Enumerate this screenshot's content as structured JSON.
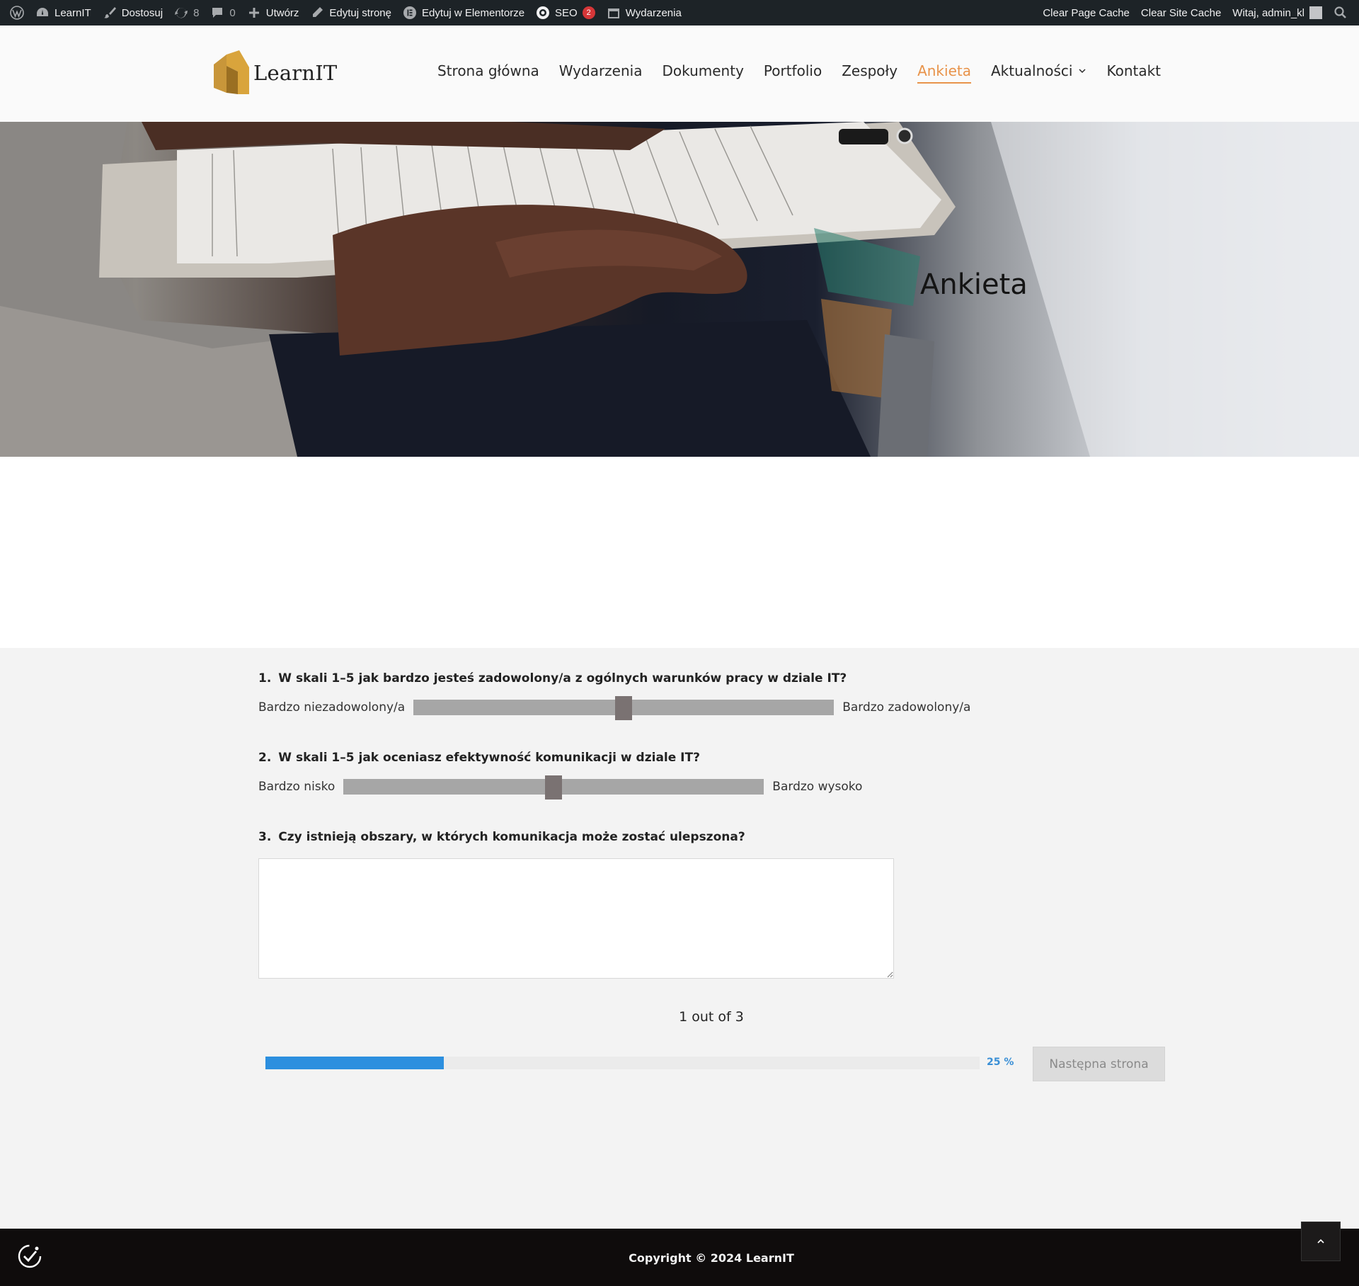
{
  "admin_bar": {
    "site_name": "LearnIT",
    "customize": "Dostosuj",
    "updates_count": "8",
    "comments_count": "0",
    "new": "Utwórz",
    "edit_page": "Edytuj stronę",
    "edit_elementor": "Edytuj w Elementorze",
    "seo": "SEO",
    "seo_badge": "2",
    "events": "Wydarzenia",
    "clear_page_cache": "Clear Page Cache",
    "clear_site_cache": "Clear Site Cache",
    "greeting": "Witaj, admin_kl"
  },
  "header": {
    "logo_text": "LearnIT",
    "nav": [
      {
        "label": "Strona główna"
      },
      {
        "label": "Wydarzenia"
      },
      {
        "label": "Dokumenty"
      },
      {
        "label": "Portfolio"
      },
      {
        "label": "Zespoły"
      },
      {
        "label": "Ankieta"
      },
      {
        "label": "Aktualności"
      },
      {
        "label": "Kontakt"
      }
    ],
    "active_item": "Ankieta",
    "accent_color": "#e8934a"
  },
  "hero": {
    "title": "Ankieta"
  },
  "survey": {
    "questions": [
      {
        "number": "1.",
        "text": "W skali 1–5 jak bardzo jesteś zadowolony/a z ogólnych warunków pracy w dziale IT?",
        "min_label": "Bardzo niezadowolony/a",
        "max_label": "Bardzo zadowolony/a",
        "slider_level": 0.5
      },
      {
        "number": "2.",
        "text": "W skali 1–5 jak oceniasz efektywność komunikacji w dziale IT?",
        "min_label": "Bardzo nisko",
        "max_label": "Bardzo wysoko",
        "slider_level": 0.5
      },
      {
        "number": "3.",
        "text": "Czy istnieją obszary, w których komunikacja może zostać ulepszona?",
        "answer": ""
      }
    ],
    "pager": "1 out of 3",
    "progress_percent": 25,
    "progress_label": "25 %",
    "progress_color": "#2c8fdf",
    "next_button": "Następna strona"
  },
  "footer": {
    "copyright": "Copyright © 2024 LearnIT"
  }
}
